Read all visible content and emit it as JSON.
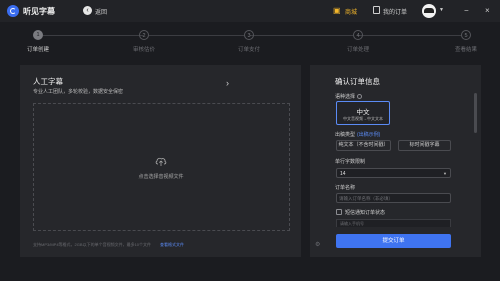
{
  "app": {
    "name": "听见字幕",
    "back_label": "返回"
  },
  "topbar": {
    "store_label": "商城",
    "orders_label": "我的订单",
    "minimize": "−",
    "close": "×"
  },
  "steps": [
    {
      "num": "1",
      "label": "订单创建"
    },
    {
      "num": "2",
      "label": "审核估价"
    },
    {
      "num": "3",
      "label": "订单支付"
    },
    {
      "num": "4",
      "label": "订单处理"
    },
    {
      "num": "5",
      "label": "查看结果"
    }
  ],
  "service": {
    "title": "人工字幕",
    "description": "专业人工团队，多轮校验，数据安全保密",
    "upload_label": "点击选择音视频文件",
    "footer_note": "支持MP3/MP4等格式，2GB以下的单个音视频文件，最多10个文件",
    "footer_link": "查看格式文件"
  },
  "order": {
    "title": "确认订单信息",
    "language_label": "语种选择",
    "language_main": "中文",
    "language_sub": "中文音视频→中文文本",
    "output_type_label": "出稿类型",
    "output_type_link": "(出稿示例)",
    "output_opt1": "纯文本（不含时间戳）",
    "output_opt2": "标时间戳字幕",
    "font_size_label": "单行字数限制",
    "font_size_value": "14",
    "order_name_label": "订单名称",
    "order_name_placeholder": "请输入订单名称（非必填）",
    "notify_label": "短信通知订单状态",
    "email_placeholder": "请输入手机号",
    "submit_label": "提交订单"
  }
}
